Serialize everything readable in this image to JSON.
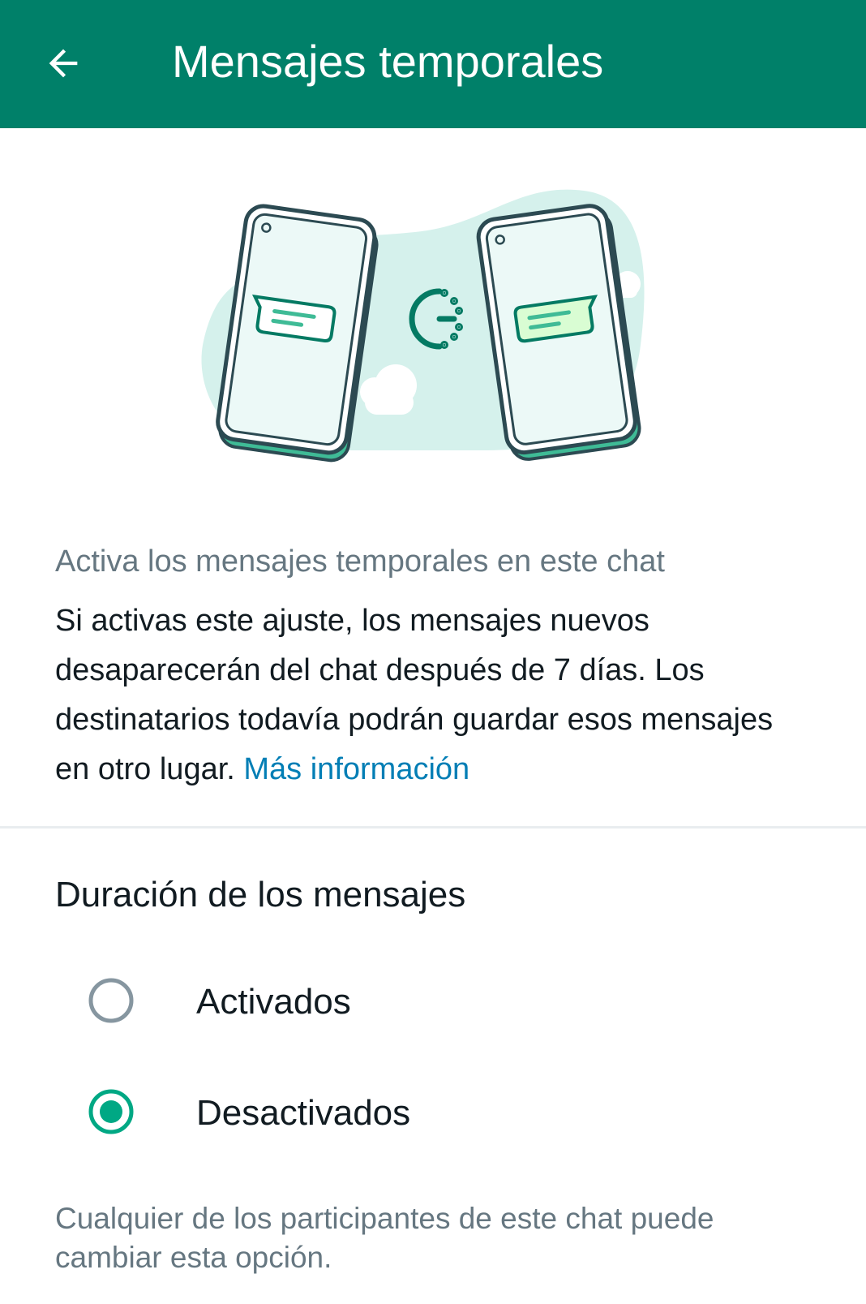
{
  "appbar": {
    "title": "Mensajes temporales",
    "back_icon": "arrow-left-icon",
    "background": "#008069"
  },
  "intro": {
    "caption": "Activa los mensajes temporales en este chat",
    "body": "Si activas este ajuste, los mensajes nuevos desaparecerán del chat después de 7 días. Los destinatarios todavía podrán guardar esos mensajes en otro lugar.",
    "link": "Más información"
  },
  "duration": {
    "title": "Duración de los mensajes",
    "options": [
      {
        "label": "Activados",
        "selected": false
      },
      {
        "label": "Desactivados",
        "selected": true
      }
    ]
  },
  "footer": {
    "note": "Cualquier de los participantes de este chat puede cambiar esta opción."
  },
  "colors": {
    "accent": "#008069",
    "radio_selected": "#00a884",
    "radio_unselected": "#8696a0",
    "link": "#027eb5",
    "secondary_text": "#667781"
  }
}
